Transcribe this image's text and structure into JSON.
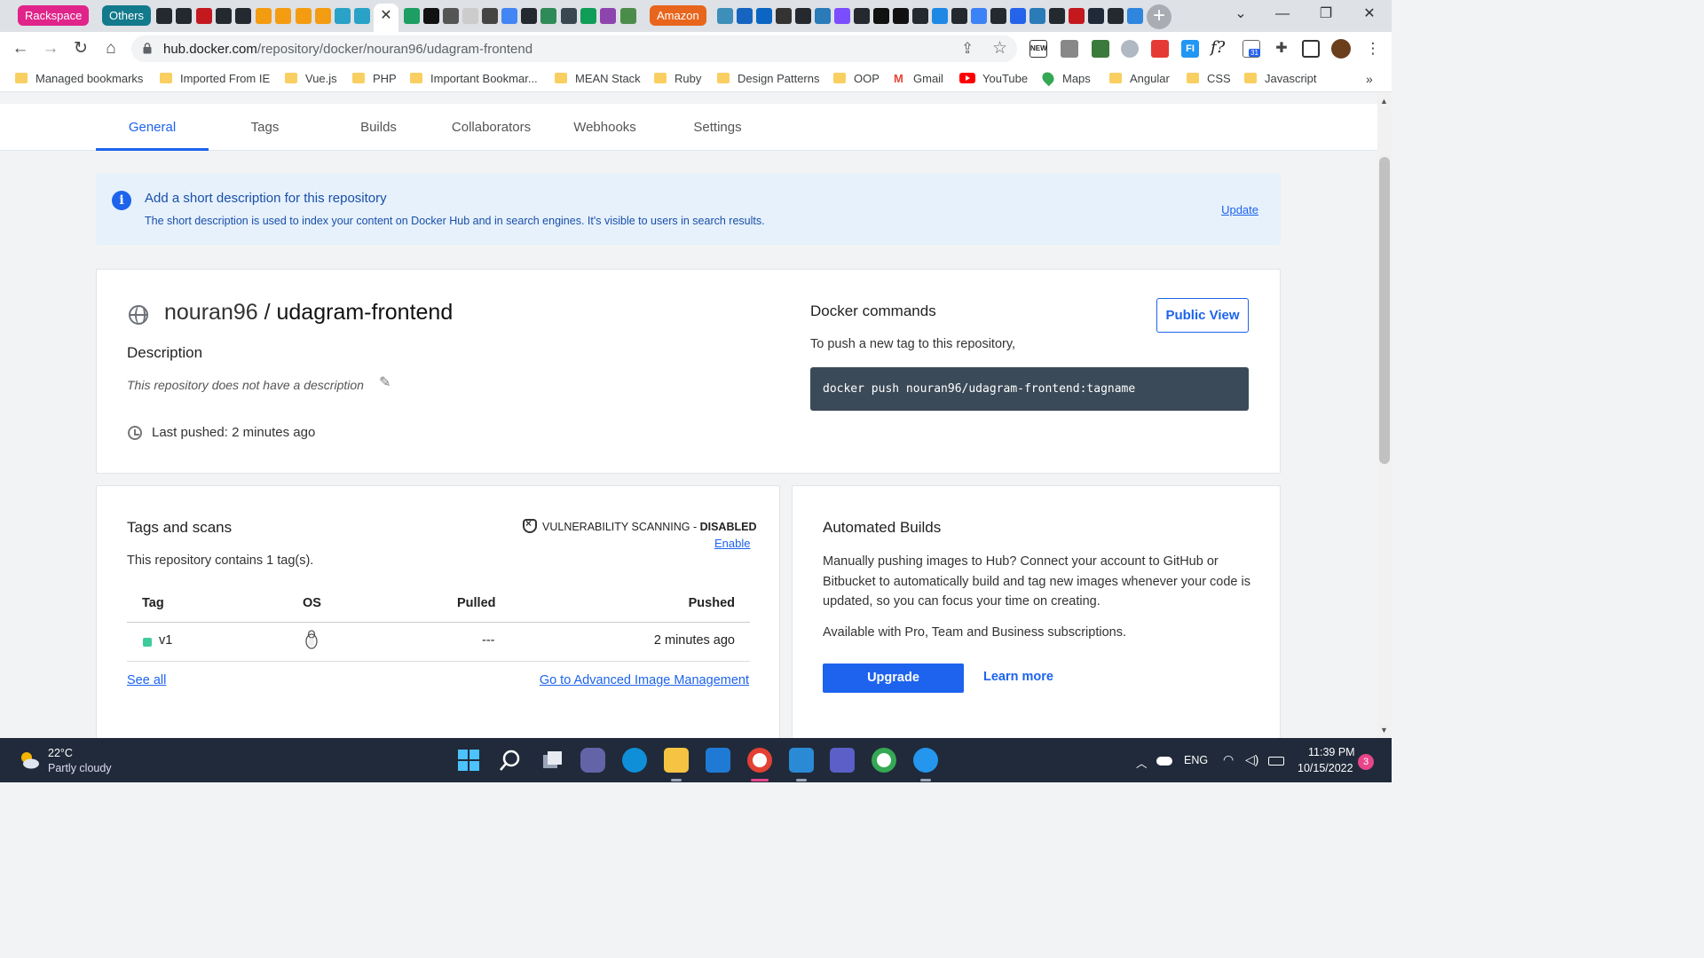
{
  "browser": {
    "tab_groups": {
      "rackspace": "Rackspace",
      "others": "Others",
      "amazon": "Amazon"
    },
    "active_tab_close": "✕",
    "new_tab": "+",
    "window_controls": {
      "collapse": "⌄",
      "minimize": "—",
      "restore": "❐",
      "close": "✕"
    },
    "url": {
      "host": "hub.docker.com",
      "path": "/repository/docker/nouran96/udagram-frontend"
    },
    "bookmarks": [
      {
        "label": "Managed bookmarks",
        "icon": "folder-icon"
      },
      {
        "label": "Imported From IE",
        "icon": "folder-icon"
      },
      {
        "label": "Vue.js",
        "icon": "folder-icon"
      },
      {
        "label": "PHP",
        "icon": "folder-icon"
      },
      {
        "label": "Important Bookmar...",
        "icon": "folder-icon"
      },
      {
        "label": "MEAN Stack",
        "icon": "folder-icon"
      },
      {
        "label": "Ruby",
        "icon": "folder-icon"
      },
      {
        "label": "Design Patterns",
        "icon": "folder-icon"
      },
      {
        "label": "OOP",
        "icon": "folder-icon"
      },
      {
        "label": "Gmail",
        "icon": "gmail-icon"
      },
      {
        "label": "YouTube",
        "icon": "youtube-icon"
      },
      {
        "label": "Maps",
        "icon": "maps-icon"
      },
      {
        "label": "Angular",
        "icon": "folder-icon"
      },
      {
        "label": "CSS",
        "icon": "folder-icon"
      },
      {
        "label": "Javascript",
        "icon": "folder-icon"
      }
    ],
    "bookmarks_overflow": "»",
    "extension_labels": {
      "new_badge": "NEW",
      "fx": "f?",
      "calendar_count": "31",
      "fi": "FI"
    }
  },
  "repo_tabs": [
    "General",
    "Tags",
    "Builds",
    "Collaborators",
    "Webhooks",
    "Settings"
  ],
  "banner": {
    "icon": "info-icon",
    "title": "Add a short description for this repository",
    "text": "The short description is used to index your content on Docker Hub and in search engines. It's visible to users in search results.",
    "update": "Update"
  },
  "repo": {
    "owner": "nouran96",
    "separator": " / ",
    "name": "udagram-frontend",
    "description_heading": "Description",
    "description_empty": "This repository does not have a description",
    "last_pushed": "Last pushed: 2 minutes ago"
  },
  "docker_commands": {
    "heading": "Docker commands",
    "subtitle": "To push a new tag to this repository,",
    "public_view": "Public View",
    "command": "docker push nouran96/udagram-frontend:tagname"
  },
  "tags_card": {
    "heading": "Tags and scans",
    "vuln_prefix": "VULNERABILITY SCANNING - ",
    "vuln_status": "DISABLED",
    "enable": "Enable",
    "summary": "This repository contains 1 tag(s).",
    "columns": [
      "Tag",
      "OS",
      "Pulled",
      "Pushed"
    ],
    "rows": [
      {
        "tag": "v1",
        "os": "linux-icon",
        "pulled": "---",
        "pushed": "2 minutes ago",
        "status_color": "#3ecb9b"
      }
    ],
    "see_all": "See all",
    "advanced": "Go to Advanced Image Management"
  },
  "automated_builds": {
    "heading": "Automated Builds",
    "body": "Manually pushing images to Hub? Connect your account to GitHub or Bitbucket to automatically build and tag new images whenever your code is updated, so you can focus your time on creating.",
    "availability": "Available with Pro, Team and Business subscriptions.",
    "upgrade": "Upgrade",
    "learn_more": "Learn more"
  },
  "taskbar": {
    "weather_temp": "22°C",
    "weather_desc": "Partly cloudy",
    "language": "ENG",
    "time": "11:39 PM",
    "date": "10/15/2022",
    "notifications": "3"
  },
  "colors": {
    "accent": "#1d63ed",
    "banner_bg": "#e6f1fc",
    "command_bg": "#3b4a58",
    "rackspace": "#e0248a",
    "others": "#137a8c",
    "amazon": "#e8651d",
    "taskbar": "#202a3a"
  }
}
